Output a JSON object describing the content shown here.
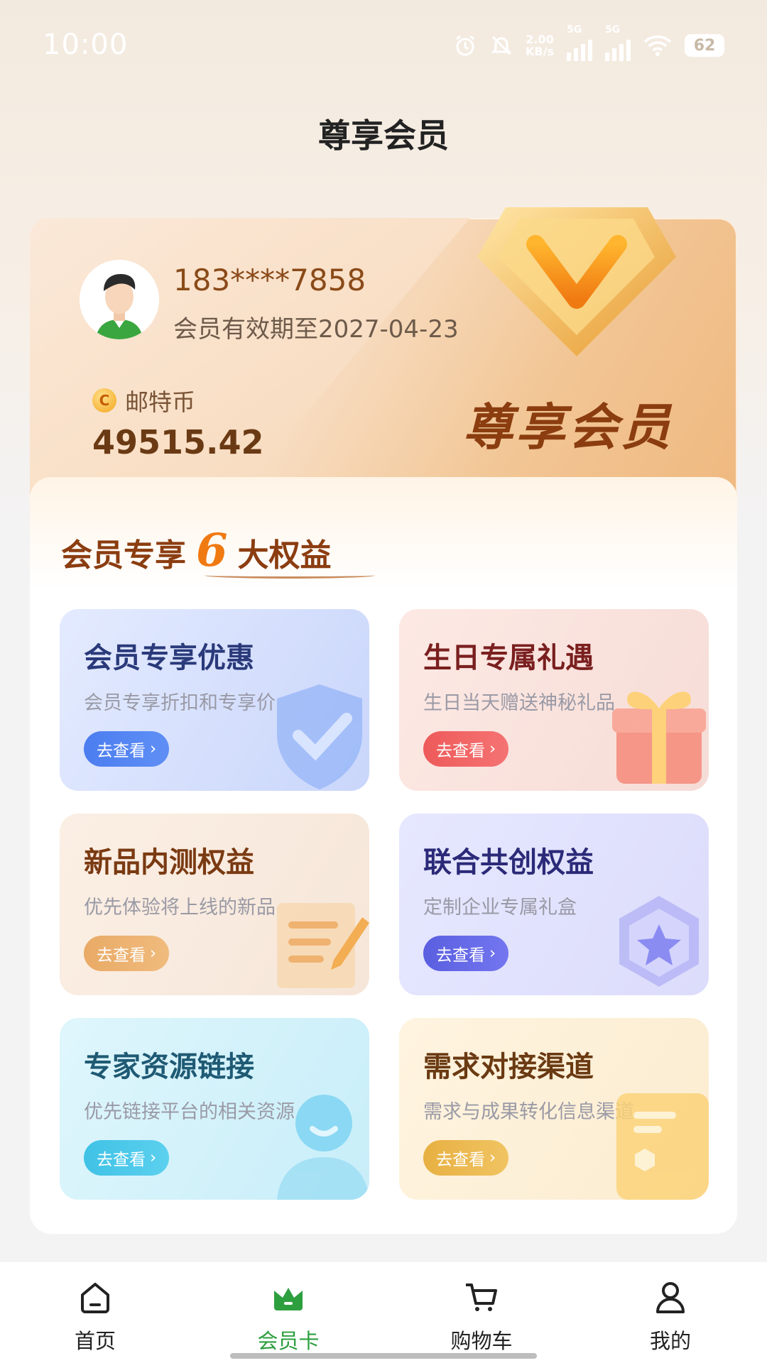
{
  "status_bar": {
    "time": "10:00",
    "net_speed_value": "2.00",
    "net_speed_unit": "KB/s",
    "sig1": "5G",
    "sig2": "5G",
    "battery": "62"
  },
  "page": {
    "title": "尊享会员"
  },
  "member_card": {
    "phone": "183****7858",
    "expiry": "会员有效期至2027-04-23",
    "coin_label": "邮特币",
    "coin_value": "49515.42",
    "coin_glyph": "C",
    "brand": "尊享会员"
  },
  "benefits": {
    "title_prefix": "会员专享",
    "count": "6",
    "title_suffix": "大权益",
    "items": [
      {
        "title": "会员专享优惠",
        "desc": "会员专享折扣和专享价",
        "button": "去查看",
        "icon": "shield-check-icon"
      },
      {
        "title": "生日专属礼遇",
        "desc": "生日当天赠送神秘礼品",
        "button": "去查看",
        "icon": "gift-icon"
      },
      {
        "title": "新品内测权益",
        "desc": "优先体验将上线的新品",
        "button": "去查看",
        "icon": "document-pen-icon"
      },
      {
        "title": "联合共创权益",
        "desc": "定制企业专属礼盒",
        "button": "去查看",
        "icon": "star-badge-icon"
      },
      {
        "title": "专家资源链接",
        "desc": "优先链接平台的相关资源",
        "button": "去查看",
        "icon": "person-icon"
      },
      {
        "title": "需求对接渠道",
        "desc": "需求与成果转化信息渠道",
        "button": "去查看",
        "icon": "card-icon"
      }
    ]
  },
  "tabbar": {
    "items": [
      {
        "label": "首页",
        "icon": "home-icon"
      },
      {
        "label": "会员卡",
        "icon": "crown-icon"
      },
      {
        "label": "购物车",
        "icon": "cart-icon"
      },
      {
        "label": "我的",
        "icon": "user-icon"
      }
    ],
    "active_index": 1
  },
  "colors": {
    "accent": "#2e9f3f",
    "brand_brown": "#8b3d10",
    "highlight_orange": "#f07a12"
  }
}
